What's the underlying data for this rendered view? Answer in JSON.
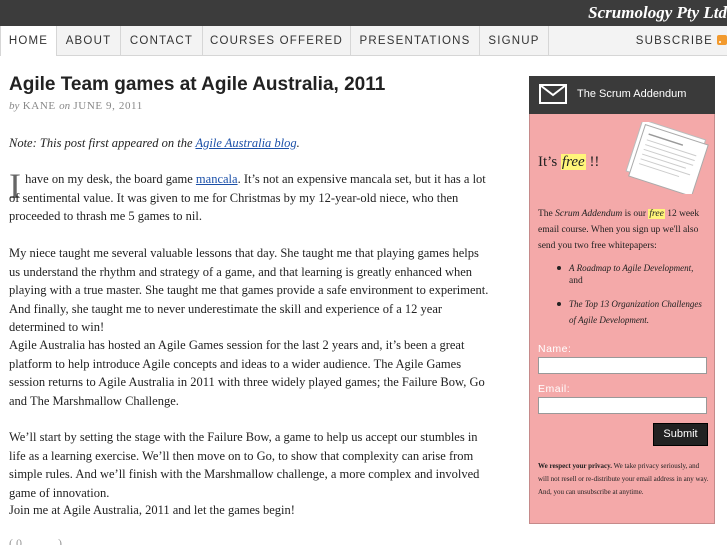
{
  "brand": "Scrumology Pty Ltd",
  "nav": {
    "items": [
      "HOME",
      "ABOUT",
      "CONTACT",
      "COURSES OFFERED",
      "PRESENTATIONS",
      "SIGNUP"
    ],
    "active": "HOME",
    "subscribe": "SUBSCRIBE",
    "subscribe_icon": "rss-icon"
  },
  "post": {
    "title": "Agile Team games at Agile Australia, 2011",
    "by_word": "by",
    "author": "KANE",
    "on_word": "on",
    "date": "JUNE 9, 2011",
    "note_prefix": "Note: This post first appeared on the",
    "note_link": "Agile Australia blog",
    "note_suffix": ".",
    "dropcap": "I",
    "p1_a": " have on my desk, the board game ",
    "p1_link": "mancala",
    "p1_b": ". It’s not an expensive mancala set, but it has a lot of sentimental value. It was given to me for Christmas by my 12-year-old niece, who then proceeded to thrash me 5 games to nil.",
    "p2": "My niece taught me several valuable lessons that day. She taught me that playing games helps us understand the rhythm and strategy of a game, and that learning is greatly enhanced when playing with a true master. She taught me that games provide a safe environment to experiment. And finally, she taught me to never underestimate the skill and experience of a 12 year determined to win!",
    "p3": "Agile Australia has hosted an Agile Games session for the last 2 years and, it’s been a great platform to help introduce Agile concepts and ideas to a wider audience. The Agile Games session returns to Agile Australia in 2011 with three widely played games; the Failure Bow, Go and The Marshmallow Challenge.",
    "p4": "We’ll start by setting the stage with the Failure Bow, a game to help us accept our stumbles in life as a learning exercise. We’ll then move on to Go, to show that complexity can arise from simple rules. And we’ll finish with the Marshmallow challenge, a more complex and involved game of innovation.",
    "p5": "Join me at Agile Australia, 2011 and let the games begin!"
  },
  "sidebar": {
    "title": "The Scrum Addendum",
    "title_icon": "envelope-icon",
    "free_prefix": "It’s ",
    "free_word": "free",
    "free_suffix": " !!",
    "desc_1": "The ",
    "desc_name": "Scrum Addendum",
    "desc_2": " is our ",
    "desc_free": "free",
    "desc_3": " 12 week email course. When you sign up we'll also send you two free whitepapers:",
    "whitepaper_1": "A Roadmap to Agile Development,",
    "and_word": "and",
    "whitepaper_2": "The Top 13 Organization Challenges of Agile Development.",
    "name_label": "Name:",
    "email_label": "Email:",
    "submit_label": "Submit",
    "privacy_bold": "We respect your privacy.",
    "privacy_text": " We take privacy seriously, and will not resell or re-distribute your email address in any way. And, you can unsubscribe at anytime."
  },
  "bottom_stub": "( 0 .......... )"
}
